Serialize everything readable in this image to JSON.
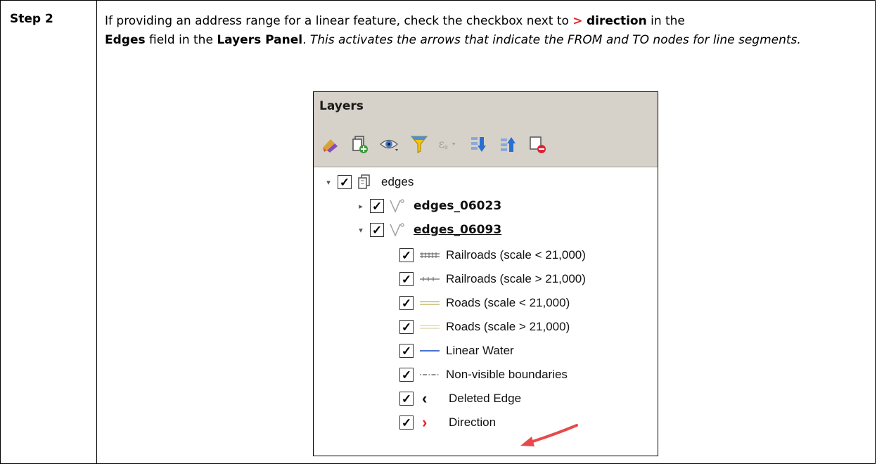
{
  "step": {
    "label": "Step 2"
  },
  "instruction": {
    "part1": "If providing an address range for a linear feature, check the checkbox next to ",
    "gt": ">",
    "direction_word": "direction",
    "part2": " in the ",
    "edges_word": "Edges",
    "part3": " field in the ",
    "panel_word": "Layers Panel",
    "part4": ". ",
    "italic": "This activates the arrows that indicate the FROM and TO nodes for line segments."
  },
  "layers_panel": {
    "title": "Layers",
    "toolbar_icons": [
      "style-icon",
      "add-group-icon",
      "visibility-icon",
      "filter-icon",
      "expression-filter-icon",
      "expand-all-icon",
      "collapse-all-icon",
      "remove-layer-icon"
    ],
    "tree": [
      {
        "label": "edges",
        "arrow": "▾",
        "checked": "✓",
        "icon": "group-layer-icon"
      },
      {
        "label": "edges_06023",
        "arrow": "▸",
        "checked": "✓",
        "icon": "line-layer-icon"
      },
      {
        "label": "edges_06093",
        "arrow": "▾",
        "checked": "✓",
        "icon": "line-layer-icon"
      },
      {
        "label": "Railroads (scale < 21,000)",
        "checked": "✓",
        "symbol": "railroad-dense-symbol"
      },
      {
        "label": "Railroads (scale > 21,000)",
        "checked": "✓",
        "symbol": "railroad-sparse-symbol"
      },
      {
        "label": "Roads (scale < 21,000)",
        "checked": "✓",
        "symbol": "road-double-symbol"
      },
      {
        "label": "Roads (scale > 21,000)",
        "checked": "✓",
        "symbol": "road-light-symbol"
      },
      {
        "label": "Linear Water",
        "checked": "✓",
        "symbol": "water-line-symbol"
      },
      {
        "label": "Non-visible boundaries",
        "checked": "✓",
        "symbol": "dashdot-line-symbol"
      },
      {
        "label": "Deleted Edge",
        "checked": "✓",
        "symbol_glyph": "‹"
      },
      {
        "label": "Direction",
        "checked": "✓",
        "symbol_glyph": "›"
      }
    ]
  },
  "colors": {
    "accent_red": "#e0262b",
    "panel_header": "#d6d2ca",
    "water_blue": "#2f5fc8",
    "road_tan": "#d8cf9a"
  }
}
